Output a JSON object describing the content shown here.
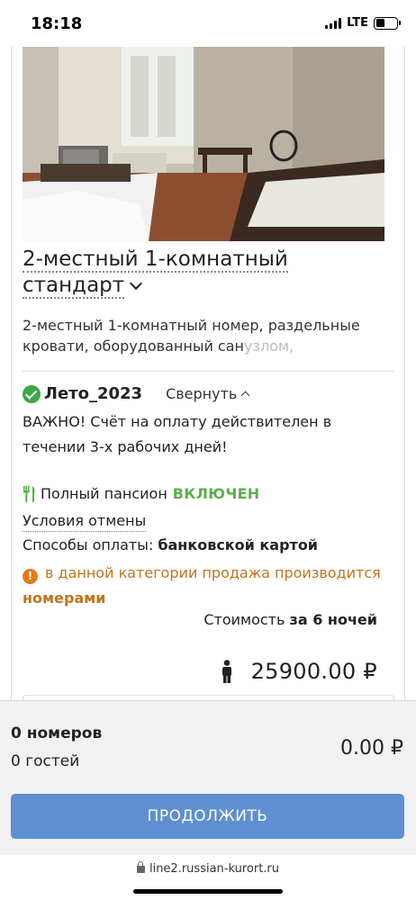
{
  "status_bar": {
    "time": "18:18",
    "network": "LTE",
    "battery_level": 0.45
  },
  "room": {
    "photo_alt": "room-photo",
    "title": "2-местный 1-комнатный стандарт",
    "description": "2-местный 1-комнатный номер, раздельные кровати, оборудованный сан",
    "description_faded": "узлом,"
  },
  "tariff": {
    "name": "Лето_2023",
    "collapse_label": "Свернуть",
    "notice": "ВАЖНО! Счёт на оплату действителен в течении 3-х рабочих дней!",
    "meal_label": "Полный пансион",
    "meal_status": "ВКЛЮЧЕН",
    "cancel_link": "Условия отмены",
    "payment_label": "Способы оплаты:",
    "payment_value": "банковской картой",
    "warning_text": "в данной категории продажа производится",
    "warning_bold": "номерами",
    "cost_label": "Стоимость",
    "cost_period": "за 6 ночей",
    "price": "25900.00 ₽"
  },
  "footer": {
    "rooms": "0 номеров",
    "guests": "0 гостей",
    "total": "0.00 ₽",
    "continue_button": "ПРОДОЛЖИТЬ"
  },
  "browser": {
    "url": "line2.russian-kurort.ru"
  },
  "colors": {
    "accent_button": "#5e8fd0",
    "included_green": "#5bb04b",
    "warning_orange": "#c1741d",
    "check_green": "#3aa84a"
  },
  "icons": [
    "signal-icon",
    "battery-icon",
    "chevron-down-icon",
    "check-circle-icon",
    "chevron-up-icon",
    "fork-knife-icon",
    "warning-icon",
    "person-icon",
    "lock-icon"
  ]
}
